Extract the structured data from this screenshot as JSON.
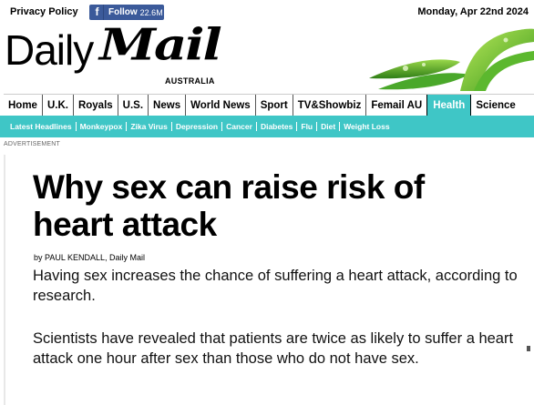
{
  "topbar": {
    "privacy_label": "Privacy Policy",
    "facebook": {
      "icon": "facebook-icon",
      "label": "Follow",
      "count": "22.6M",
      "color": "#3b5a9a"
    },
    "date": "Monday, Apr 22nd 2024"
  },
  "logo": {
    "daily": "Daily",
    "mail": "Mail",
    "region": "AUSTRALIA"
  },
  "nav": {
    "items": [
      {
        "label": "Home"
      },
      {
        "label": "U.K."
      },
      {
        "label": "Royals"
      },
      {
        "label": "U.S."
      },
      {
        "label": "News"
      },
      {
        "label": "World News"
      },
      {
        "label": "Sport"
      },
      {
        "label": "TV&Showbiz"
      },
      {
        "label": "Femail AU"
      },
      {
        "label": "Health",
        "active": true
      },
      {
        "label": "Science"
      }
    ],
    "accent": "#3fc6c6"
  },
  "subnav": {
    "items": [
      "Latest Headlines",
      "Monkeypox",
      "Zika Virus",
      "Depression",
      "Cancer",
      "Diabetes",
      "Flu",
      "Diet",
      "Weight Loss"
    ]
  },
  "ad_label": "ADVERTISEMENT",
  "article": {
    "headline": "Why sex can raise risk of heart attack",
    "byline_prefix": "by ",
    "author": "PAUL KENDALL, Daily Mail",
    "paragraphs": [
      "Having sex increases the chance of suffering a heart attack, according to research.",
      "Scientists have revealed that patients are twice as likely to suffer a heart attack one hour after sex than those who do not have sex."
    ]
  }
}
